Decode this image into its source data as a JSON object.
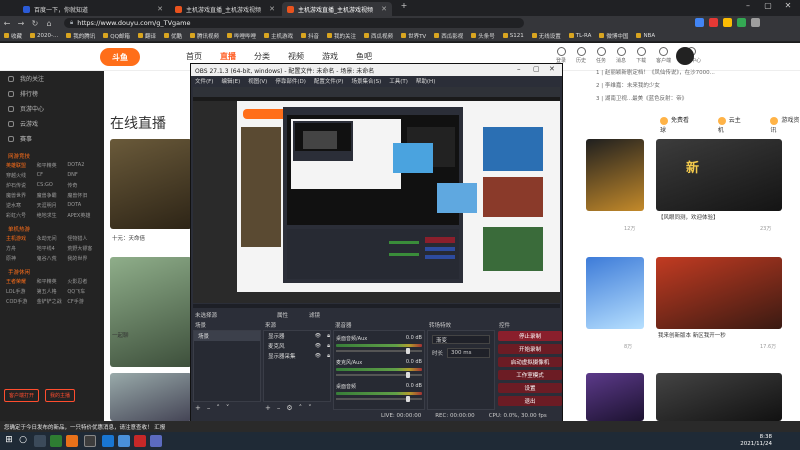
{
  "browser": {
    "tabs": [
      {
        "title": "百度一下，你就知道"
      },
      {
        "title": "主机游戏直播_主机游戏视频"
      },
      {
        "title": "主机游戏直播_主机游戏视频"
      }
    ],
    "url": "https://www.douyu.com/g_TVgame",
    "bookmarks": [
      "收藏",
      "2020-...",
      "我的腾讯",
      "QQ邮箱",
      "翻译",
      "优酷",
      "腾讯视频",
      "哔哩哔哩",
      "主机游戏",
      "抖音",
      "我的关注",
      "西瓜视频",
      "世界TV",
      "西瓜影视",
      "头条号",
      "S121",
      "无线设置",
      "TL-RA",
      "微博中国",
      "NBA"
    ]
  },
  "douyu": {
    "logo": "斗鱼",
    "nav": [
      {
        "label": "首页"
      },
      {
        "label": "直播"
      },
      {
        "label": "分类"
      },
      {
        "label": "视频"
      },
      {
        "label": "游戏"
      },
      {
        "label": "鱼吧"
      }
    ],
    "header_icons": [
      "登录",
      "历史",
      "任务",
      "消息",
      "下载",
      "客户端",
      "创作中心"
    ],
    "hot_list": [
      "1 | 赵丽颖新剧定档！《凤仙传说》，在沙7000...",
      "2 | 李维嘉：未来我的少女",
      "3 | 湖南卫视...最美《蓝色反射：帝》"
    ],
    "page_title": "在线直播",
    "sidebar": {
      "top_items": [
        "我的关注",
        "排行榜",
        "页游中心",
        "云游戏",
        "赛事"
      ],
      "section_games": "网游竞技",
      "games": [
        "英雄联盟",
        "和平精英",
        "DOTA2",
        "穿越火线",
        "CF",
        "DNF",
        "炉石传说",
        "CS:GO",
        "传奇",
        "魔兽世界",
        "魔兽争霸",
        "魔兽怀旧",
        "逆水寒",
        "天涯明月",
        "DOTA",
        "彩虹六号",
        "绝地求生",
        "APEX英雄"
      ],
      "section_console": "单机热游",
      "console": [
        "主机游戏",
        "永劫无间",
        "怪物猎人",
        "方舟",
        "地平线4",
        "荒野大镖客",
        "原神",
        "鬼谷八荒",
        "我的世界"
      ],
      "section_mobile": "手游休闲",
      "mobile": [
        "王者荣耀",
        "和平精英",
        "火影忍者",
        "LOL手游",
        "第五人格",
        "QQ飞车",
        "COD手游",
        "金铲铲之战",
        "CF手游"
      ],
      "buttons": [
        "客户端打开",
        "我的主播"
      ]
    },
    "cards": [
      {
        "title": "十元：天命倍",
        "sub": "精彩游戏",
        "viewers": "5.7万"
      },
      {
        "title": "一起聊",
        "sub": "游戏",
        "viewers": "4万"
      },
      {
        "title": "【风眼同测，欢迎体验】",
        "sub": "精彩",
        "viewers": "23万"
      },
      {
        "title": "新人主播",
        "sub": "游戏",
        "viewers": "12万"
      },
      {
        "title": "我来创新版本 新区我开一秒",
        "sub": "游戏",
        "viewers": "17.6万"
      },
      {
        "title": "单机主播",
        "sub": "游戏",
        "viewers": "8万"
      }
    ],
    "right_tags": [
      "免费看球",
      "云主机",
      "游戏资讯"
    ]
  },
  "obs": {
    "title": "OBS 27.1.3 (64-bit, windows) - 配置文件: 未命名 - 场景: 未命名",
    "menu": [
      "文件(F)",
      "编辑(E)",
      "视图(V)",
      "停靠部件(D)",
      "配置文件(P)",
      "场景集合(S)",
      "工具(T)",
      "帮助(H)"
    ],
    "hint": "未选择源",
    "properties_label": "属性",
    "filters_label": "滤镜",
    "docks": {
      "scenes": "场景",
      "sources": "来源",
      "mixer": "混音器",
      "transitions": "转场特效",
      "controls": "控件"
    },
    "scenes_list": [
      "场景"
    ],
    "sources_list": [
      "显示器",
      "麦克风",
      "显示器采集"
    ],
    "mixer_tracks": [
      {
        "name": "桌面音频/Aux",
        "db": "0.0 dB"
      },
      {
        "name": "麦克风/Aux",
        "db": "0.0 dB"
      },
      {
        "name": "桌面音频",
        "db": "0.0 dB"
      }
    ],
    "transition": {
      "type": "渐变",
      "duration_label": "时长",
      "duration": "300 ms"
    },
    "controls_buttons": [
      "停止录制",
      "开始录制",
      "启动虚拟摄像机",
      "工作室模式",
      "设置",
      "退出"
    ],
    "status": {
      "live": "LIVE: 00:00:00",
      "rec": "REC: 00:00:00",
      "cpu": "CPU: 0.0%, 30.00 fps"
    }
  },
  "notification": "您确定于今日发布的新品，一只特价优惠消息，请注意查收！ 汇报",
  "taskbar": {
    "time": "8:38",
    "date": "2021/11/24"
  },
  "colors": {
    "accent": "#ff5d23",
    "obs_bg": "#2b2e38",
    "obs_btn": "#8a1f2c"
  }
}
